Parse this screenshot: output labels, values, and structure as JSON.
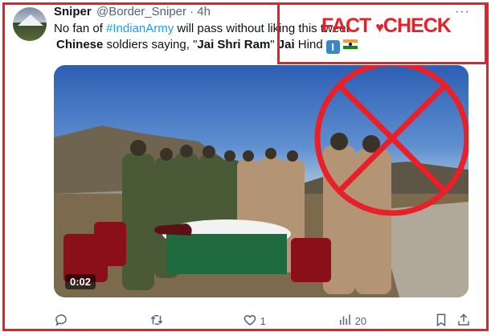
{
  "tweet": {
    "author_name": "Sniper",
    "author_handle": "@Border_Sniper · 4h",
    "text_part1": "No fan of ",
    "hashtag": "#IndianArmy",
    "text_part2": " will pass without liking this tweet",
    "text_bold1": "Chinese",
    "text_part3": " soldiers saying, \"",
    "text_bold2": "Jai Shri Ram",
    "text_part4": "\" ",
    "text_bold3": "Jai",
    "text_part5": " Hind",
    "i_badge": "I",
    "more_label": "···"
  },
  "overlay": {
    "fact_check_part1": "FACT",
    "fact_check_part2": "CHECK",
    "accent_color": "#e8202a"
  },
  "media": {
    "timer": "0:02"
  },
  "actions": {
    "reply_count": "",
    "retweet_count": "",
    "like_count": "1",
    "views_count": "20"
  },
  "icons": [
    "reply-icon",
    "retweet-icon",
    "like-icon",
    "views-icon",
    "bookmark-icon",
    "share-icon",
    "heart-icon",
    "flag-icon"
  ]
}
